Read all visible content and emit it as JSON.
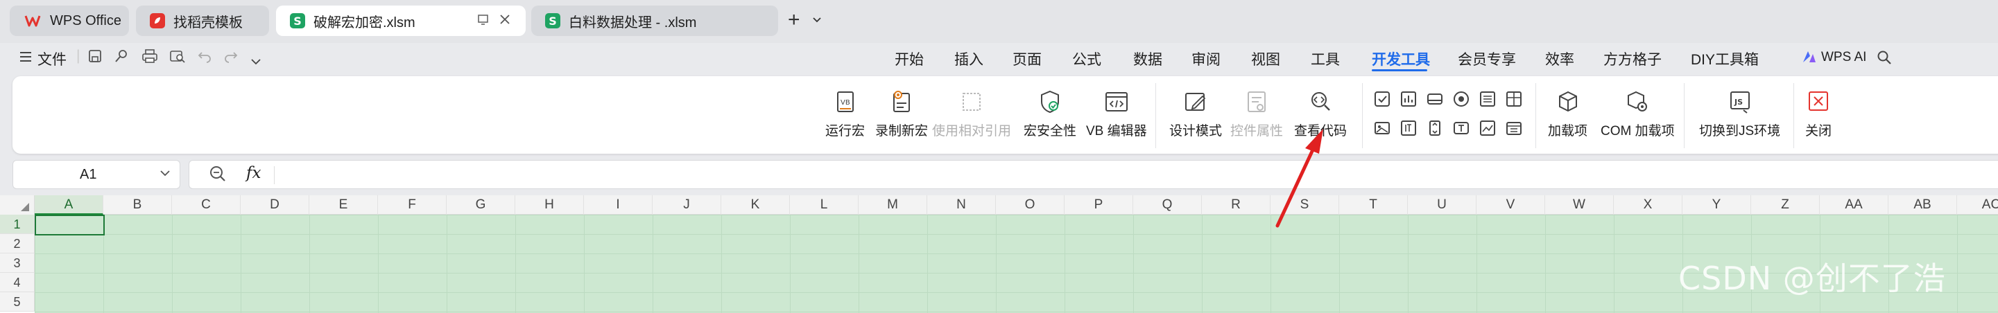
{
  "tabs": [
    {
      "label": "WPS Office",
      "icon": "wps-logo-icon"
    },
    {
      "label": "找稻壳模板",
      "icon": "docer-icon"
    },
    {
      "label": "破解宏加密.xlsm",
      "icon": "spreadsheet-icon",
      "active": true
    },
    {
      "label": "白料数据处理 - .xlsm",
      "icon": "spreadsheet-icon"
    }
  ],
  "tab_spreadsheet_glyph": "S",
  "quick_access": {
    "file_label": "文件"
  },
  "menu": [
    "开始",
    "插入",
    "页面",
    "公式",
    "数据",
    "审阅",
    "视图",
    "工具",
    "开发工具",
    "会员专享",
    "效率",
    "方方格子",
    "DIY工具箱"
  ],
  "active_menu": "开发工具",
  "wps_ai_label": "WPS AI",
  "ribbon": {
    "run_macro": "运行宏",
    "record_macro": "录制新宏",
    "relative_ref": "使用相对引用",
    "macro_security": "宏安全性",
    "vb_editor": "VB 编辑器",
    "design_mode": "设计模式",
    "control_props": "控件属性",
    "view_code": "查看代码",
    "addins": "加载项",
    "com_addins": "COM 加载项",
    "switch_js": "切换到JS环境",
    "close": "关闭"
  },
  "formula_bar": {
    "name_box": "A1",
    "fx_label": "fx"
  },
  "columns": [
    "A",
    "B",
    "C",
    "D",
    "E",
    "F",
    "G",
    "H",
    "I",
    "J",
    "K",
    "L",
    "M",
    "N",
    "O",
    "P",
    "Q",
    "R",
    "S",
    "T",
    "U",
    "V",
    "W",
    "X",
    "Y",
    "Z",
    "AA",
    "AB",
    "AC"
  ],
  "rows": [
    "1",
    "2",
    "3",
    "4",
    "5"
  ],
  "watermark": "CSDN @创不了浩",
  "colors": {
    "accent": "#1f6bea",
    "sheet_green": "#cde8d1",
    "arrow": "#e02020"
  }
}
